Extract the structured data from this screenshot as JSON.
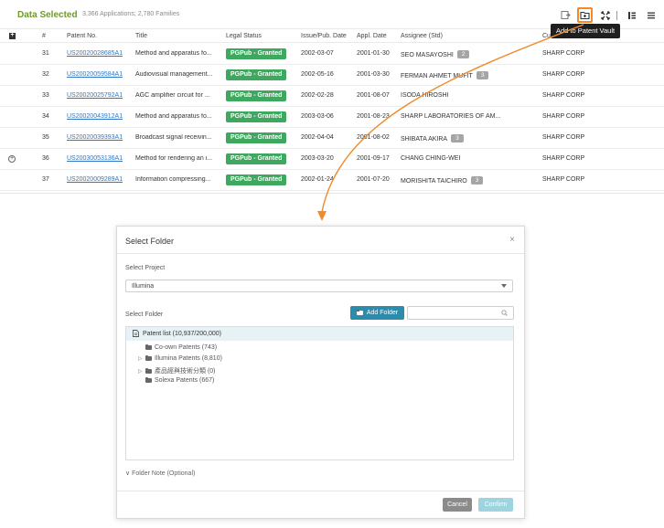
{
  "header": {
    "title": "Data Selected",
    "summary": "3,366 Applications; 2,780 Families",
    "tooltip": "Add to Patent Vault"
  },
  "toolbar": {
    "icons": [
      "export-icon",
      "add-to-vault-icon",
      "fullscreen-icon",
      "columns-icon",
      "list-icon"
    ],
    "accent_color": "#f08a2b"
  },
  "columns": [
    "#",
    "Patent No.",
    "Title",
    "Legal Status",
    "Issue/Pub. Date",
    "Appl. Date",
    "Assignee (Std)",
    "Cu"
  ],
  "rows": [
    {
      "num": "31",
      "patent": "US20020028685A1",
      "title": "Method and apparatus fo...",
      "status": "PGPub - Granted",
      "issue": "2002-03-07",
      "appl": "2001-01-30",
      "assignee": "SEO MASAYOSHI",
      "assignee_count": "2",
      "current": "SHARP CORP"
    },
    {
      "num": "32",
      "patent": "US20020059584A1",
      "title": "Audiovisual management...",
      "status": "PGPub - Granted",
      "issue": "2002-05-16",
      "appl": "2001-03-30",
      "assignee": "FERMAN AHMET MUFIT",
      "assignee_count": "3",
      "current": "SHARP CORP"
    },
    {
      "num": "33",
      "patent": "US20020025792A1",
      "title": "AGC amplifier circuit for ...",
      "status": "PGPub - Granted",
      "issue": "2002-02-28",
      "appl": "2001-08-07",
      "assignee": "ISODA HIROSHI",
      "assignee_count": "",
      "current": "SHARP CORP"
    },
    {
      "num": "34",
      "patent": "US20020043912A1",
      "title": "Method and apparatus fo...",
      "status": "PGPub - Granted",
      "issue": "2003-03-06",
      "appl": "2001-08-23",
      "assignee": "SHARP LABORATORIES OF AM...",
      "assignee_count": "",
      "current": "SHARP CORP"
    },
    {
      "num": "35",
      "patent": "US20020039393A1",
      "title": "Broadcast signal receivin...",
      "status": "PGPub - Granted",
      "issue": "2002-04-04",
      "appl": "2001-08-02",
      "assignee": "SHIBATA AKIRA",
      "assignee_count": "3",
      "current": "SHARP CORP"
    },
    {
      "num": "36",
      "patent": "US20030053136A1",
      "title": "Method for rendering an i...",
      "status": "PGPub - Granted",
      "issue": "2003-03-20",
      "appl": "2001-09-17",
      "assignee": "CHANG CHING-WEI",
      "assignee_count": "",
      "current": "SHARP CORP"
    },
    {
      "num": "37",
      "patent": "US20020009289A1",
      "title": "Information compressing...",
      "status": "PGPub - Granted",
      "issue": "2002-01-24",
      "appl": "2001-07-20",
      "assignee": "MORISHITA TAICHIRO",
      "assignee_count": "3",
      "current": "SHARP CORP"
    }
  ],
  "status_color": "#3ea85f",
  "dialog": {
    "title": "Select Folder",
    "project_label": "Select Project",
    "project_value": "Illumina",
    "folder_label": "Select Folder",
    "add_folder_label": "Add Folder",
    "search_placeholder": "",
    "root": "Patent list (10,937/200,000)",
    "folders": [
      {
        "label": "Co-own Patents (743)",
        "expandable": false
      },
      {
        "label": "Illumina Patents (8,810)",
        "expandable": true
      },
      {
        "label": "產品經與技術分類 (0)",
        "expandable": true
      },
      {
        "label": "Solexa Patents (667)",
        "expandable": false
      }
    ],
    "note_label": "Folder Note (Optional)",
    "cancel_label": "Cancel",
    "confirm_label": "Confirm",
    "primary_color": "#2d8cab"
  }
}
